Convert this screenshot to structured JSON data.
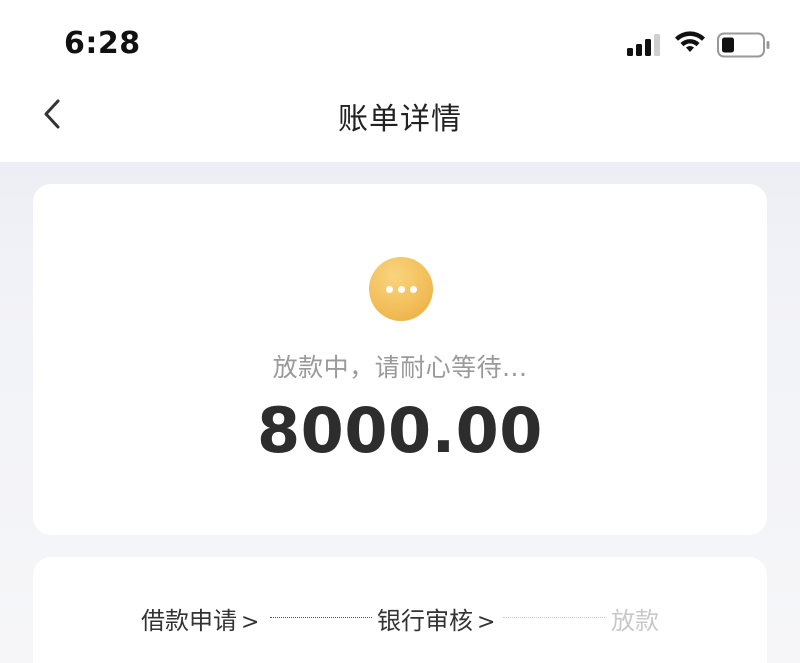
{
  "status_bar": {
    "time": "6:28",
    "icons": [
      "signal-icon",
      "wifi-icon",
      "battery-icon"
    ]
  },
  "nav": {
    "back_icon": "chevron-left-icon",
    "title": "账单详情"
  },
  "status_card": {
    "icon": "pending-dots-icon",
    "icon_color": "#f2bf5b",
    "status_text": "放款中，请耐心等待...",
    "amount": "8000.00"
  },
  "progress": {
    "steps": [
      {
        "label": "借款申请",
        "arrow": ">",
        "state": "done"
      },
      {
        "label": "银行审核",
        "arrow": ">",
        "state": "done"
      },
      {
        "label": "放款",
        "state": "pending"
      }
    ]
  },
  "colors": {
    "text_primary": "#2d2d2d",
    "text_muted": "#9a9a9a",
    "step_inactive": "#c8c8c8"
  }
}
